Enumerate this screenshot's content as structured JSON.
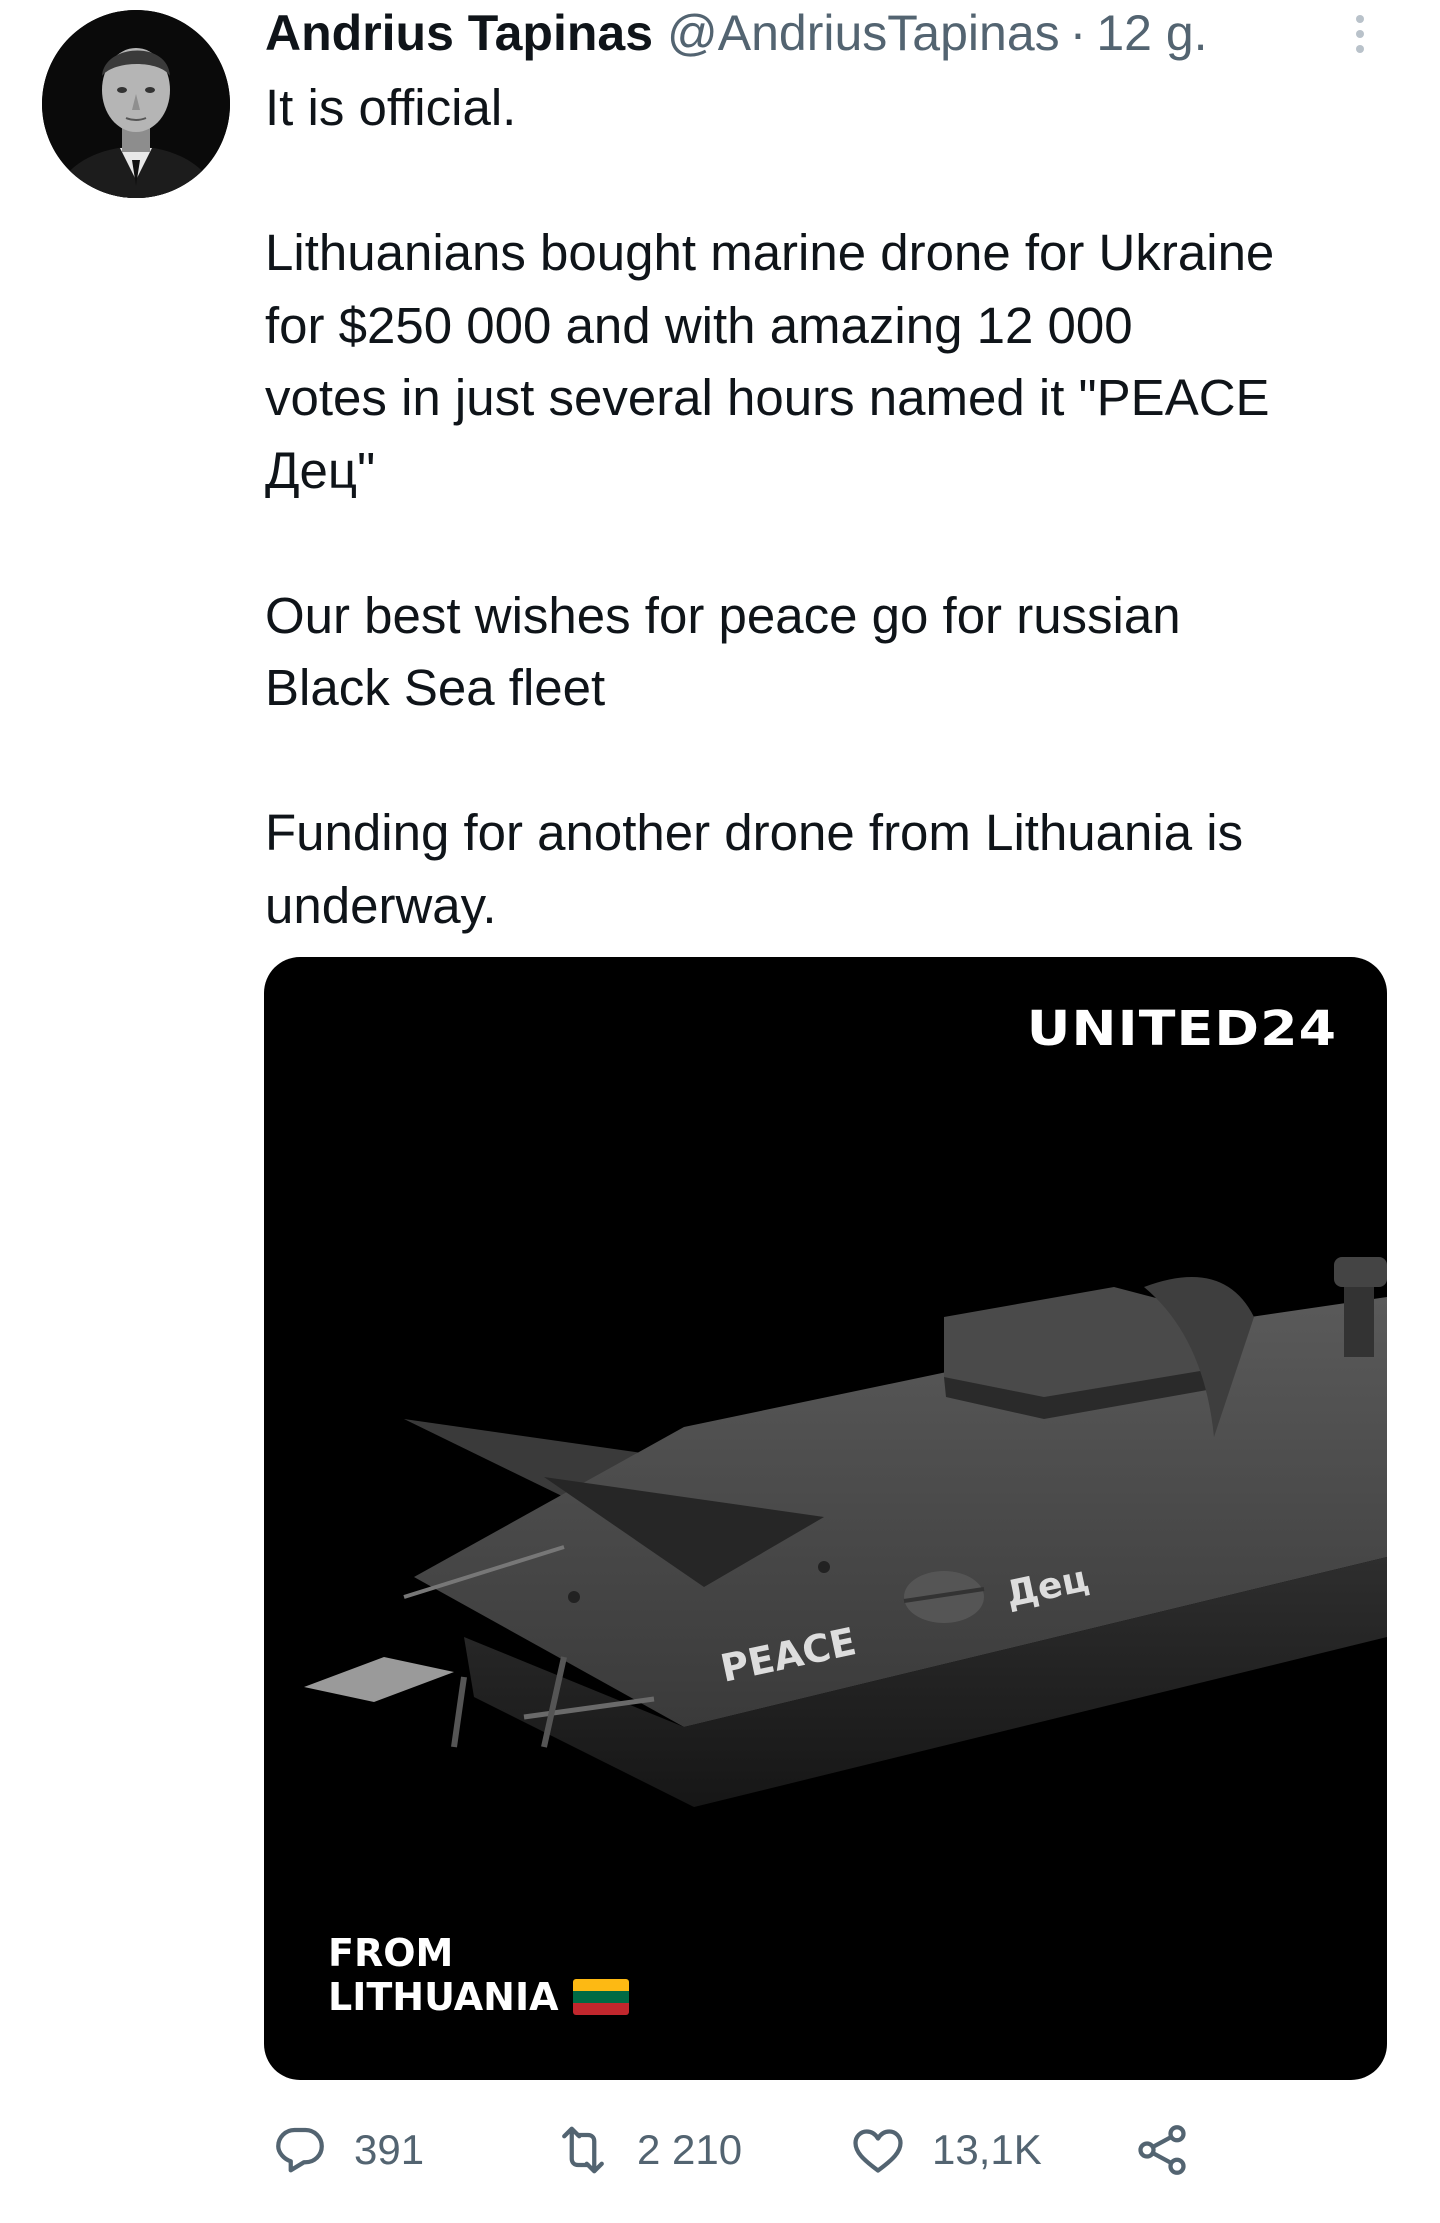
{
  "tweet": {
    "author": {
      "display_name": "Andrius Tapinas",
      "handle": "@AndriusTapinas"
    },
    "separator": "·",
    "time": "12 g.",
    "paragraphs": [
      "It is official.",
      "Lithuanians bought marine drone for Ukraine\nfor $250 000 and with amazing 12 000\nvotes in just several hours named it \"PEACE\nДец\"",
      "Our best wishes for peace go for russian\nBlack Sea fleet",
      "Funding for another drone from Lithuania is\nunderway."
    ],
    "media": {
      "logo_text": "UNITED24",
      "hull_text_left": "PEACE",
      "hull_text_right": "Дец",
      "footer_line1": "FROM",
      "footer_line2": "LITHUANIA",
      "flag_colors": [
        "#FDB913",
        "#006A44",
        "#C1272D"
      ]
    },
    "actions": {
      "reply_count": "391",
      "retweet_count": "2 210",
      "like_count": "13,1K"
    },
    "colors": {
      "text": "#0f1419",
      "secondary": "#536471",
      "media_bg": "#000000"
    }
  }
}
